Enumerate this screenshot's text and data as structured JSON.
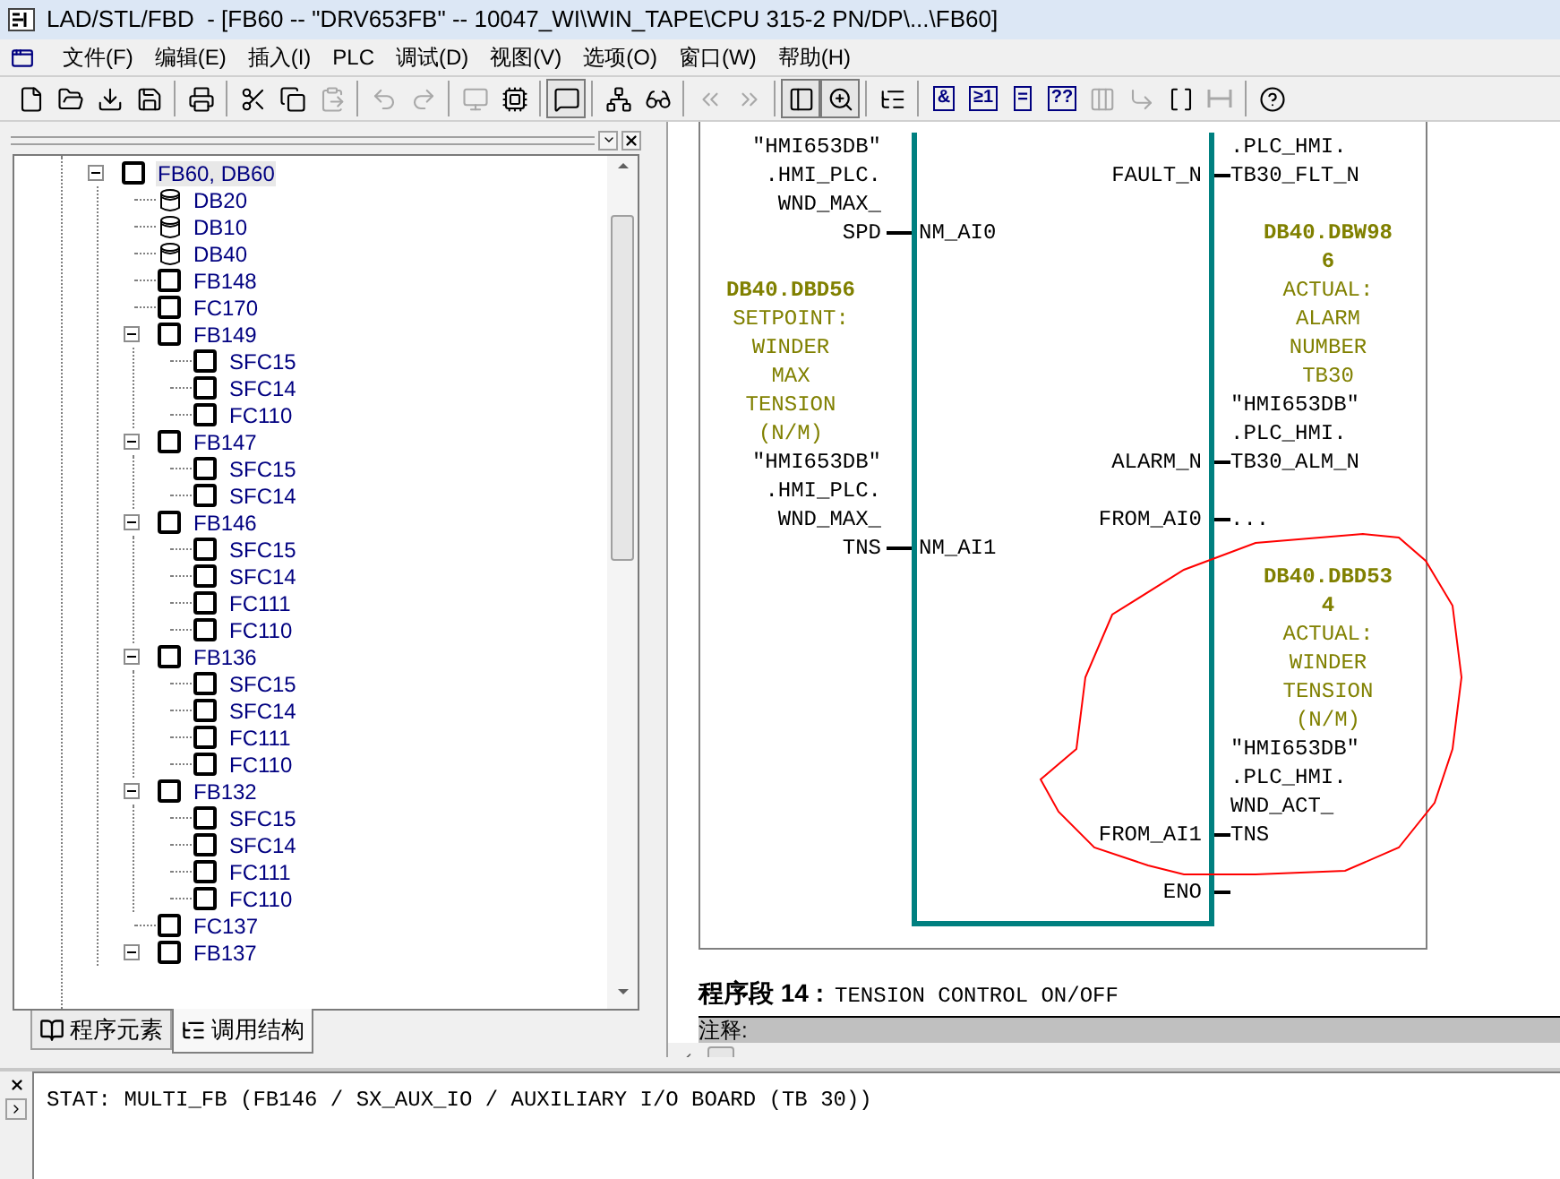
{
  "window": {
    "title": "LAD/STL/FBD  - [FB60 -- \"DRV653FB\" -- 10047_WI\\WIN_TAPE\\CPU 315-2 PN/DP\\...\\FB60]"
  },
  "menu": [
    "文件(F)",
    "编辑(E)",
    "插入(I)",
    "PLC",
    "调试(D)",
    "视图(V)",
    "选项(O)",
    "窗口(W)",
    "帮助(H)"
  ],
  "toolbar": [
    {
      "kind": "new",
      "disabled": false,
      "pressed": false
    },
    {
      "kind": "open",
      "disabled": false,
      "pressed": false
    },
    {
      "kind": "download",
      "disabled": false,
      "pressed": false
    },
    {
      "kind": "save",
      "disabled": false,
      "pressed": false
    },
    {
      "kind": "separator"
    },
    {
      "kind": "print",
      "disabled": false,
      "pressed": false
    },
    {
      "kind": "separator"
    },
    {
      "kind": "cut",
      "disabled": false,
      "pressed": false
    },
    {
      "kind": "copy",
      "disabled": false,
      "pressed": false
    },
    {
      "kind": "paste",
      "disabled": true,
      "pressed": false
    },
    {
      "kind": "separator"
    },
    {
      "kind": "undo",
      "disabled": true,
      "pressed": false
    },
    {
      "kind": "redo",
      "disabled": true,
      "pressed": false
    },
    {
      "kind": "separator"
    },
    {
      "kind": "monitor",
      "disabled": true,
      "pressed": false
    },
    {
      "kind": "module",
      "disabled": false,
      "pressed": false
    },
    {
      "kind": "separator"
    },
    {
      "kind": "comment",
      "disabled": false,
      "pressed": true
    },
    {
      "kind": "separator"
    },
    {
      "kind": "network",
      "disabled": false,
      "pressed": false
    },
    {
      "kind": "glasses",
      "disabled": false,
      "pressed": false
    },
    {
      "kind": "separator"
    },
    {
      "kind": "previous",
      "disabled": true,
      "pressed": false
    },
    {
      "kind": "next",
      "disabled": true,
      "pressed": false
    },
    {
      "kind": "separator"
    },
    {
      "kind": "overview",
      "disabled": false,
      "pressed": true
    },
    {
      "kind": "zoom",
      "disabled": false,
      "pressed": true
    },
    {
      "kind": "separator"
    },
    {
      "kind": "list",
      "disabled": false,
      "pressed": false
    },
    {
      "kind": "separator"
    },
    {
      "kind": "glyph",
      "text": "&",
      "disabled": false,
      "pressed": false
    },
    {
      "kind": "glyph",
      "text": "≥1",
      "disabled": false,
      "pressed": false
    },
    {
      "kind": "glyph",
      "text": "=",
      "disabled": false,
      "pressed": false
    },
    {
      "kind": "glyph",
      "text": "??",
      "disabled": false,
      "pressed": false
    },
    {
      "kind": "branch",
      "disabled": true,
      "pressed": false
    },
    {
      "kind": "insert",
      "disabled": true,
      "pressed": false
    },
    {
      "kind": "open-branch",
      "disabled": false,
      "pressed": false
    },
    {
      "kind": "close-branch",
      "disabled": true,
      "pressed": false
    },
    {
      "kind": "separator"
    },
    {
      "kind": "help",
      "disabled": false,
      "pressed": false
    }
  ],
  "tree": [
    {
      "label": "FB60, DB60",
      "kind": "block",
      "selected": true,
      "expanded": true,
      "children": [
        {
          "label": "DB20",
          "kind": "db",
          "selected": false
        },
        {
          "label": "DB10",
          "kind": "db",
          "selected": false
        },
        {
          "label": "DB40",
          "kind": "db",
          "selected": false
        },
        {
          "label": "FB148",
          "kind": "block",
          "selected": false
        },
        {
          "label": "FC170",
          "kind": "block",
          "selected": false
        },
        {
          "label": "FB149",
          "kind": "block",
          "selected": false,
          "expanded": true,
          "children": [
            {
              "label": "SFC15",
              "kind": "block",
              "selected": false
            },
            {
              "label": "SFC14",
              "kind": "block",
              "selected": false
            },
            {
              "label": "FC110",
              "kind": "block",
              "selected": false
            }
          ]
        },
        {
          "label": "FB147",
          "kind": "block",
          "selected": false,
          "expanded": true,
          "children": [
            {
              "label": "SFC15",
              "kind": "block",
              "selected": false
            },
            {
              "label": "SFC14",
              "kind": "block",
              "selected": false
            }
          ]
        },
        {
          "label": "FB146",
          "kind": "block",
          "selected": false,
          "expanded": true,
          "children": [
            {
              "label": "SFC15",
              "kind": "block",
              "selected": false
            },
            {
              "label": "SFC14",
              "kind": "block",
              "selected": false
            },
            {
              "label": "FC111",
              "kind": "block",
              "selected": false
            },
            {
              "label": "FC110",
              "kind": "block",
              "selected": false
            }
          ]
        },
        {
          "label": "FB136",
          "kind": "block",
          "selected": false,
          "expanded": true,
          "children": [
            {
              "label": "SFC15",
              "kind": "block",
              "selected": false
            },
            {
              "label": "SFC14",
              "kind": "block",
              "selected": false
            },
            {
              "label": "FC111",
              "kind": "block",
              "selected": false
            },
            {
              "label": "FC110",
              "kind": "block",
              "selected": false
            }
          ]
        },
        {
          "label": "FB132",
          "kind": "block",
          "selected": false,
          "expanded": true,
          "children": [
            {
              "label": "SFC15",
              "kind": "block",
              "selected": false
            },
            {
              "label": "SFC14",
              "kind": "block",
              "selected": false
            },
            {
              "label": "FC111",
              "kind": "block",
              "selected": false
            },
            {
              "label": "FC110",
              "kind": "block",
              "selected": false
            }
          ]
        },
        {
          "label": "FC137",
          "kind": "block",
          "selected": false
        },
        {
          "label": "FB137",
          "kind": "block",
          "selected": false,
          "expanded": true
        }
      ]
    }
  ],
  "tabs": [
    {
      "label": "程序元素",
      "selected": false
    },
    {
      "label": "调用结构",
      "selected": true
    }
  ],
  "diagram": {
    "inputs": [
      {
        "pin": "NM_AI0",
        "lines": [
          {
            "text": "\"HMI653DB\"",
            "kind": "symbol"
          },
          {
            "text": ".HMI_PLC.",
            "kind": "symbol"
          },
          {
            "text": "WND_MAX_",
            "kind": "symbol"
          },
          {
            "text": "SPD",
            "kind": "symbol"
          }
        ]
      },
      {
        "pin": "NM_AI1",
        "lines": [
          {
            "text": "DB40.DBD56",
            "kind": "address"
          },
          {
            "text": "SETPOINT:",
            "kind": "comment"
          },
          {
            "text": "WINDER",
            "kind": "comment"
          },
          {
            "text": "MAX",
            "kind": "comment"
          },
          {
            "text": "TENSION",
            "kind": "comment"
          },
          {
            "text": "(N/M)",
            "kind": "comment"
          },
          {
            "text": "\"HMI653DB\"",
            "kind": "symbol"
          },
          {
            "text": ".HMI_PLC.",
            "kind": "symbol"
          },
          {
            "text": "WND_MAX_",
            "kind": "symbol"
          },
          {
            "text": "TNS",
            "kind": "symbol"
          }
        ]
      }
    ],
    "outputs": [
      {
        "pin": "FAULT_N",
        "lines": [
          {
            "text": ".PLC_HMI.",
            "kind": "symbol"
          },
          {
            "text": "TB30_FLT_N",
            "kind": "symbol"
          }
        ]
      },
      {
        "pin": "ALARM_N",
        "lines": [
          {
            "text": "DB40.DBW98",
            "kind": "address"
          },
          {
            "text": "6",
            "kind": "address"
          },
          {
            "text": "ACTUAL:",
            "kind": "comment"
          },
          {
            "text": "ALARM",
            "kind": "comment"
          },
          {
            "text": "NUMBER",
            "kind": "comment"
          },
          {
            "text": "TB30",
            "kind": "comment"
          },
          {
            "text": "\"HMI653DB\"",
            "kind": "symbol"
          },
          {
            "text": ".PLC_HMI.",
            "kind": "symbol"
          },
          {
            "text": "TB30_ALM_N",
            "kind": "symbol"
          }
        ]
      },
      {
        "pin": "FROM_AI0",
        "lines": [
          {
            "text": "...",
            "kind": "symbol"
          }
        ]
      },
      {
        "pin": "FROM_AI1",
        "lines": [
          {
            "text": "DB40.DBD53",
            "kind": "address"
          },
          {
            "text": "4",
            "kind": "address"
          },
          {
            "text": "ACTUAL:",
            "kind": "comment"
          },
          {
            "text": "WINDER",
            "kind": "comment"
          },
          {
            "text": "TENSION",
            "kind": "comment"
          },
          {
            "text": "(N/M)",
            "kind": "comment"
          },
          {
            "text": "\"HMI653DB\"",
            "kind": "symbol"
          },
          {
            "text": ".PLC_HMI.",
            "kind": "symbol"
          },
          {
            "text": "WND_ACT_",
            "kind": "symbol"
          },
          {
            "text": "TNS",
            "kind": "symbol"
          }
        ]
      },
      {
        "pin": "ENO"
      }
    ]
  },
  "network": {
    "label": "程序段 14 :",
    "title": "TENSION CONTROL ON/OFF",
    "comment_label": "注释:"
  },
  "output": {
    "text": "STAT: MULTI_FB (FB146 / SX_AUX_IO / AUXILIARY I/O BOARD (TB 30))"
  }
}
